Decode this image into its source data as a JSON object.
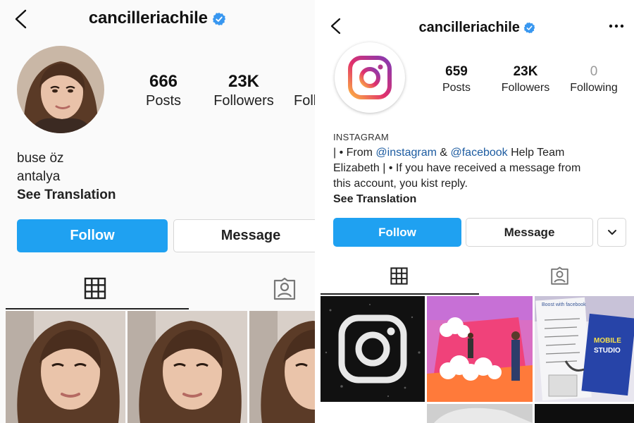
{
  "left": {
    "username": "cancilleriachile",
    "stats": {
      "posts_value": "666",
      "posts_label": "Posts",
      "followers_value": "23K",
      "followers_label": "Followers",
      "following_label": "Following"
    },
    "bio": {
      "name": "buse öz",
      "location": "antalya",
      "see_translation": "See Translation"
    },
    "buttons": {
      "follow": "Follow",
      "message": "Message"
    },
    "tabs": [
      "grid-icon",
      "tagged-icon"
    ]
  },
  "right": {
    "username": "cancilleriachile",
    "stats": {
      "posts_value": "659",
      "posts_label": "Posts",
      "followers_value": "23K",
      "followers_label": "Followers",
      "following_value": "0",
      "following_label": "Following"
    },
    "bio": {
      "category": "INSTAGRAM",
      "line1_prefix": "| • From ",
      "mention1": "@instagram",
      "line1_mid": " & ",
      "mention2": "@facebook",
      "line1_suffix": " Help Team",
      "line2": "Elizabeth | • If you have received a message from",
      "line3": "this account, you kist reply.",
      "see_translation": "See Translation"
    },
    "buttons": {
      "follow": "Follow",
      "message": "Message"
    },
    "grid_text": {
      "boost": "Boost with facebook",
      "mobile": "MOBILE",
      "studio": "STUDIO"
    }
  },
  "colors": {
    "accent": "#1fa1f1",
    "verified": "#3897f0",
    "mention": "#1c5ba0"
  }
}
